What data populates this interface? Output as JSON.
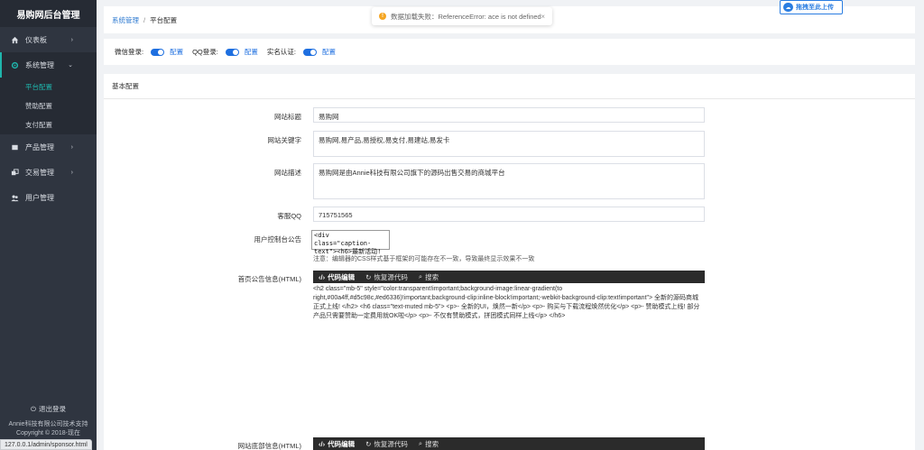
{
  "sidebar": {
    "brand": "易购网后台管理",
    "items": [
      {
        "label": "仪表板",
        "icon": "home-icon"
      },
      {
        "label": "系统管理",
        "icon": "gear-icon"
      },
      {
        "label": "产品管理",
        "icon": "box-icon"
      },
      {
        "label": "交易管理",
        "icon": "cart-icon"
      },
      {
        "label": "用户管理",
        "icon": "users-icon"
      }
    ],
    "subitems": [
      "平台配置",
      "赞助配置",
      "支付配置"
    ],
    "logout": "退出登录",
    "footer_line1": "Annie科技有限公司技术支持",
    "footer_line2": "Copyright © 2018-现在"
  },
  "status_url": "127.0.0.1/admin/sponsor.html",
  "breadcrumb": {
    "parent": "系统管理",
    "sep": "/",
    "current": "平台配置"
  },
  "toast": {
    "message": "数据加载失败：ReferenceError: ace is not defined",
    "close": "×"
  },
  "upload": {
    "label": "拖拽至此上传"
  },
  "toggles": [
    {
      "label": "微信登录:",
      "state": "配置"
    },
    {
      "label": "QQ登录:",
      "state": "配置"
    },
    {
      "label": "实名认证:",
      "state": "配置"
    }
  ],
  "config": {
    "heading": "基本配置",
    "site_title_label": "网站标题",
    "site_title_value": "易购网",
    "keywords_label": "网站关键字",
    "keywords_value": "易购网,易产品,易授权,易支付,易建站,易发卡",
    "description_label": "网站描述",
    "description_value": "易购网是由Annie科技有限公司旗下的源码出售交易的商城平台",
    "qq_label": "客服QQ",
    "qq_value": "715751565",
    "notice_label": "用户控制台公告",
    "notice_value": "<div class=\"caption-text\"><h6>最新活动!",
    "notice_hint": "注意：编辑器的CSS样式基于框架的可能存在不一致，导致最终显示效果不一致",
    "home_notice_label": "首页公告信息(HTML)",
    "home_notice_code": "<h2 class=\"mb-5\" style=\"color:transparent!important;background-image:linear-gradient(to right,#00a4ff,#d5c98c,#ed6336)!important;background-clip:inline-block!important;-webkit-background-clip:text!important\"> 全新的源码商城正式上线! </h2> <h6 class=\"text-muted mb-5\"> <p>- 全新的UI，焕然一新</p> <p>- 购买与下载流程焕然优化</p> <p>- 赞助模式上线! 部分产品只需要赞助一定费用就OK啦</p> <p>- 不仅有赞助模式，拼团模式同样上线</p> </h6>",
    "footer_label": "网站底部信息(HTML)",
    "editor_buttons": [
      "代码编辑",
      "恢复源代码",
      "搜索"
    ]
  },
  "colors": {
    "accent": "#1fb5ac",
    "link": "#2f7bd1",
    "switch": "#1e6fe0",
    "sidebar": "#2f3540"
  }
}
